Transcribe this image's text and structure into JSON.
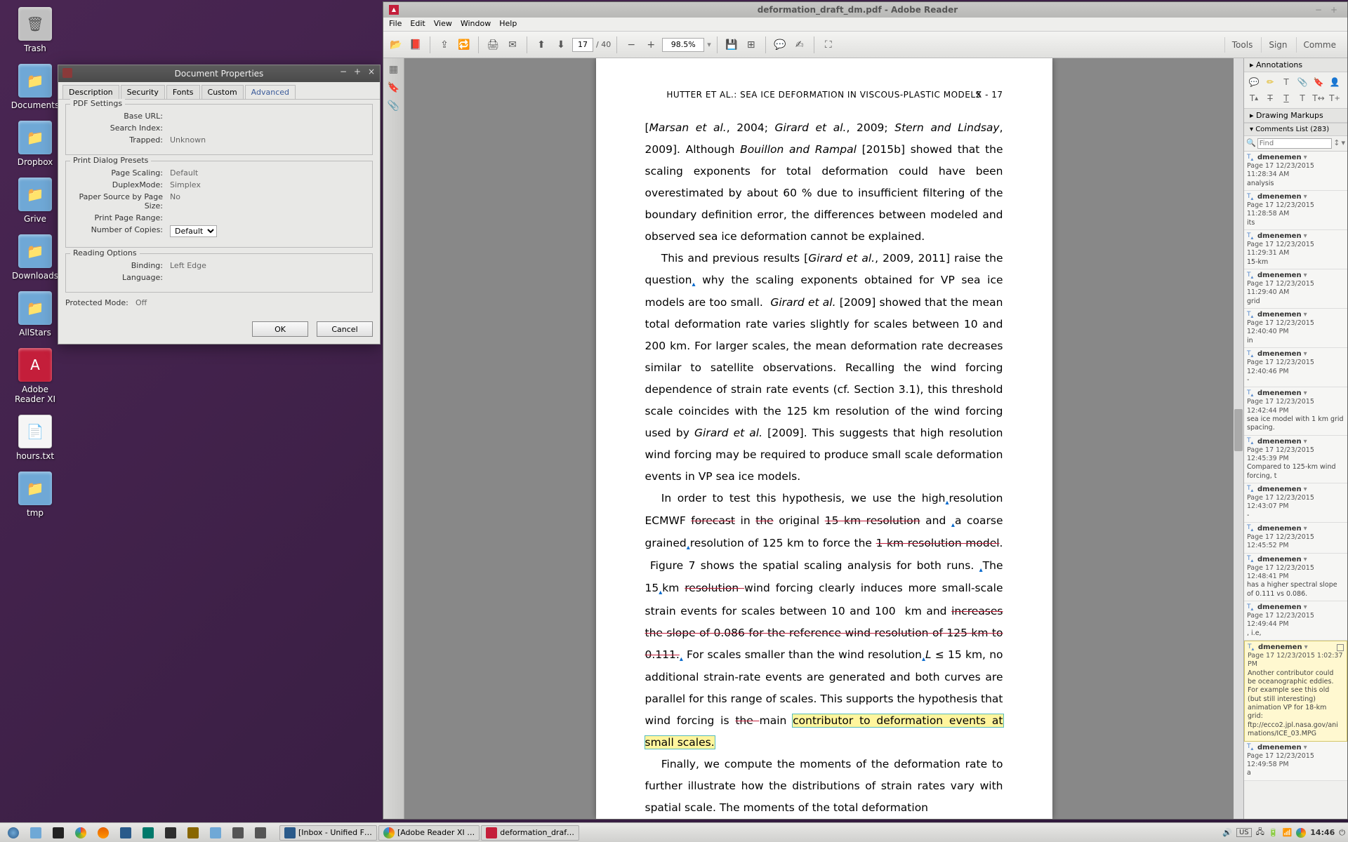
{
  "desktop": {
    "icons": [
      {
        "label": "Trash",
        "type": "trash"
      },
      {
        "label": "Documents",
        "type": "folder"
      },
      {
        "label": "Dropbox",
        "type": "folder"
      },
      {
        "label": "Grive",
        "type": "folder"
      },
      {
        "label": "Downloads",
        "type": "folder"
      },
      {
        "label": "AllStars",
        "type": "folder"
      },
      {
        "label": "Adobe Reader XI",
        "type": "app-red"
      },
      {
        "label": "hours.txt",
        "type": "file"
      },
      {
        "label": "tmp",
        "type": "folder"
      }
    ]
  },
  "dialog": {
    "title": "Document Properties",
    "tabs": [
      "Description",
      "Security",
      "Fonts",
      "Custom",
      "Advanced"
    ],
    "active_tab": 4,
    "pdf_settings": {
      "legend": "PDF Settings",
      "base_url_label": "Base URL:",
      "base_url": "",
      "search_index_label": "Search Index:",
      "search_index": "",
      "trapped_label": "Trapped:",
      "trapped": "Unknown"
    },
    "print_presets": {
      "legend": "Print Dialog Presets",
      "page_scaling_label": "Page Scaling:",
      "page_scaling": "Default",
      "duplex_label": "DuplexMode:",
      "duplex": "Simplex",
      "paper_source_label": "Paper Source by Page Size:",
      "paper_source": "No",
      "print_range_label": "Print Page Range:",
      "print_range": "",
      "copies_label": "Number of Copies:",
      "copies": "Default"
    },
    "reading": {
      "legend": "Reading Options",
      "binding_label": "Binding:",
      "binding": "Left Edge",
      "language_label": "Language:",
      "language": ""
    },
    "protected_label": "Protected Mode:",
    "protected": "Off",
    "ok": "OK",
    "cancel": "Cancel"
  },
  "reader": {
    "title": "deformation_draft_dm.pdf - Adobe Reader",
    "menus": [
      "File",
      "Edit",
      "View",
      "Window",
      "Help"
    ],
    "page_current": "17",
    "page_total": "/  40",
    "zoom": "98.5%",
    "right_buttons": [
      "Tools",
      "Sign",
      "Comme"
    ],
    "doc": {
      "header": "HUTTER ET AL.:  SEA ICE DEFORMATION IN VISCOUS-PLASTIC MODELS",
      "pagenum": "X - 17"
    },
    "anno": {
      "title": "Annotations",
      "markups": "Drawing Markups",
      "comments_title": "Comments List (283)",
      "find_placeholder": "Find"
    },
    "comments": [
      {
        "name": "dmenemen",
        "meta": "Page 17  12/23/2015 11:28:34 AM",
        "body": "analysis",
        "icon": "T"
      },
      {
        "name": "dmenemen",
        "meta": "Page 17  12/23/2015 11:28:58 AM",
        "body": "its",
        "icon": "T"
      },
      {
        "name": "dmenemen",
        "meta": "Page 17  12/23/2015 11:29:31 AM",
        "body": "15-km",
        "icon": "T"
      },
      {
        "name": "dmenemen",
        "meta": "Page 17  12/23/2015 11:29:40 AM",
        "body": "grid",
        "icon": "T"
      },
      {
        "name": "dmenemen",
        "meta": "Page 17  12/23/2015 12:40:40 PM",
        "body": "in",
        "icon": "T"
      },
      {
        "name": "dmenemen",
        "meta": "Page 17  12/23/2015 12:40:46 PM",
        "body": "-",
        "icon": "T"
      },
      {
        "name": "dmenemen",
        "meta": "Page 17  12/23/2015 12:42:44 PM",
        "body": "sea ice model with 1 km grid spacing.",
        "icon": "T"
      },
      {
        "name": "dmenemen",
        "meta": "Page 17  12/23/2015 12:45:39 PM",
        "body": "Compared to 125-km wind forcing, t",
        "icon": "T"
      },
      {
        "name": "dmenemen",
        "meta": "Page 17  12/23/2015 12:43:07 PM",
        "body": "-",
        "icon": "T"
      },
      {
        "name": "dmenemen",
        "meta": "Page 17  12/23/2015 12:45:52 PM",
        "body": "",
        "icon": "T"
      },
      {
        "name": "dmenemen",
        "meta": "Page 17  12/23/2015 12:48:41 PM",
        "body": "has a higher spectral slope of 0.111 vs 0.086.",
        "icon": "T"
      },
      {
        "name": "dmenemen",
        "meta": "Page 17  12/23/2015 12:49:44 PM",
        "body": ", i.e,",
        "icon": "T"
      },
      {
        "name": "dmenemen",
        "meta": "Page 17  12/23/2015 1:02:37 PM",
        "body": "Another contributor could be oceanographic eddies. For example see this old (but still interesting) animation VP for 18-km grid: ftp://ecco2.jpl.nasa.gov/animations/ICE_03.MPG",
        "icon": "T",
        "selected": true
      },
      {
        "name": "dmenemen",
        "meta": "Page 17  12/23/2015 12:49:58 PM",
        "body": "a",
        "icon": "T"
      }
    ]
  },
  "taskbar": {
    "tasks": [
      {
        "label": "[Inbox - Unified F…",
        "color": "#4a88c8"
      },
      {
        "label": "[Adobe Reader XI …",
        "color": "#2a7e43"
      },
      {
        "label": "deformation_draf…",
        "color": "#c41e3a"
      }
    ],
    "clock": "14:46",
    "kbd": "US"
  }
}
